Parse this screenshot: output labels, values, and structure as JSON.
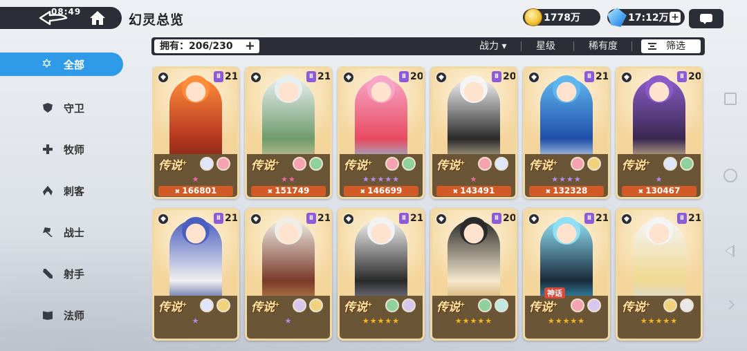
{
  "header": {
    "title": "幻灵总览",
    "status_time": "08:49"
  },
  "resources": {
    "gold": "1778万",
    "stamina": "17:12万"
  },
  "filterbar": {
    "owned": "拥有：206/230",
    "sort_power": "战力 ▾",
    "sort_star": "星级",
    "sort_rarity": "稀有度",
    "filter": "筛选"
  },
  "sidebar": {
    "items": [
      {
        "label": "全部",
        "icon": "star-outline-icon"
      },
      {
        "label": "守卫",
        "icon": "shield-icon"
      },
      {
        "label": "牧师",
        "icon": "cross-icon"
      },
      {
        "label": "刺客",
        "icon": "hood-icon"
      },
      {
        "label": "战士",
        "icon": "axe-icon"
      },
      {
        "label": "射手",
        "icon": "bow-icon"
      },
      {
        "label": "法师",
        "icon": "book-icon"
      }
    ]
  },
  "colors": {
    "accent": "#2f9be8",
    "dark": "#2b2e37",
    "power": "#d25a27",
    "tier": "#8e5bd8",
    "stars_pink": "#f06aa8",
    "stars_purple": "#b58cf3",
    "stars_gold": "#f4b81e"
  },
  "cards": [
    {
      "class": "bow",
      "tier": "Ⅱ",
      "level": "21",
      "rarity": "传说",
      "stars": "★",
      "star_color": "#f06aa8",
      "power": "166801",
      "elements": [
        "#dfe6ff",
        "#f5a3b0"
      ],
      "palette": [
        "#ff8c3a",
        "#b3361f",
        "#7a2a1a"
      ]
    },
    {
      "class": "shield",
      "tier": "Ⅱ",
      "level": "21",
      "rarity": "传说",
      "stars": "★★",
      "star_color": "#f06aa8",
      "power": "151749",
      "elements": [
        "#f5a3b0",
        "#8fd19a"
      ],
      "palette": [
        "#e7eef0",
        "#6e9b6a",
        "#d8c8a0"
      ]
    },
    {
      "class": "axe",
      "tier": "Ⅱ",
      "level": "20",
      "rarity": "传说",
      "stars": "★★★★★",
      "star_color": "#b58cf3",
      "power": "146699",
      "elements": [
        "#f5a3b0",
        "#8fd19a"
      ],
      "palette": [
        "#f7a6c8",
        "#e84a5f",
        "#7fd0e8"
      ]
    },
    {
      "class": "hood",
      "tier": "Ⅱ",
      "level": "20",
      "rarity": "传说",
      "stars": "★",
      "star_color": "#f06aa8",
      "power": "143491",
      "elements": [
        "#f5a3b0",
        "#dfe6ff"
      ],
      "palette": [
        "#f4f4f4",
        "#2a2a2a",
        "#d9c9a8"
      ]
    },
    {
      "class": "book",
      "tier": "Ⅱ",
      "level": "21",
      "rarity": "传说",
      "stars": "★★★★",
      "star_color": "#b58cf3",
      "power": "132328",
      "elements": [
        "#f5a3b0",
        "#f1d27a"
      ],
      "palette": [
        "#5fb6ef",
        "#1f4fa8",
        "#e7f2fb"
      ]
    },
    {
      "class": "axe",
      "tier": "Ⅱ",
      "level": "20",
      "rarity": "传说",
      "stars": "★",
      "star_color": "#b58cf3",
      "power": "130467",
      "elements": [
        "#dfe6ff",
        "#8fd19a"
      ],
      "palette": [
        "#8a5bc7",
        "#3a2850",
        "#f0d8a0"
      ]
    },
    {
      "class": "cross",
      "tier": "Ⅱ",
      "level": "21",
      "rarity": "传说",
      "stars": "★",
      "star_color": "#b58cf3",
      "power": "",
      "elements": [
        "#dfe6ff",
        "#f1d27a"
      ],
      "palette": [
        "#4a5fbf",
        "#f0f0f0",
        "#2a3e8a"
      ]
    },
    {
      "class": "cross",
      "tier": "Ⅱ",
      "level": "21",
      "rarity": "传说",
      "stars": "★",
      "star_color": "#b58cf3",
      "power": "",
      "elements": [
        "#d7c7ef",
        "#f1d27a"
      ],
      "palette": [
        "#f0ece6",
        "#7a3a2a",
        "#c09050"
      ]
    },
    {
      "class": "bow",
      "tier": "Ⅱ",
      "level": "21",
      "rarity": "传说",
      "stars": "★★★★★",
      "star_color": "#f4b81e",
      "power": "",
      "elements": [
        "#8fd19a",
        "#d7c7ef"
      ],
      "palette": [
        "#f2f2f2",
        "#2a2a2a",
        "#8a8fa0"
      ]
    },
    {
      "class": "hood",
      "tier": "Ⅱ",
      "level": "20",
      "rarity": "传说",
      "stars": "★★★★★",
      "star_color": "#f4b81e",
      "power": "",
      "elements": [
        "#8fd19a",
        "#bfe9e0"
      ],
      "palette": [
        "#2a2a2a",
        "#f5e8cc",
        "#caa050"
      ]
    },
    {
      "class": "book",
      "tier": "Ⅱ",
      "level": "21",
      "rarity": "传说",
      "mythic": "神话",
      "stars": "★★★★★",
      "star_color": "#f4b81e",
      "power": "",
      "elements": [
        "#f5a3b0",
        "#d7c7ef"
      ],
      "palette": [
        "#8fe0f5",
        "#1a2a3a",
        "#3fb0d8"
      ]
    },
    {
      "class": "book",
      "tier": "Ⅱ",
      "level": "21",
      "rarity": "传说",
      "stars": "★★★★★",
      "star_color": "#f4b81e",
      "power": "",
      "elements": [
        "#f1d27a",
        "#e8e8e8"
      ],
      "palette": [
        "#f4f4f4",
        "#f0d890",
        "#d8dce8"
      ]
    }
  ]
}
